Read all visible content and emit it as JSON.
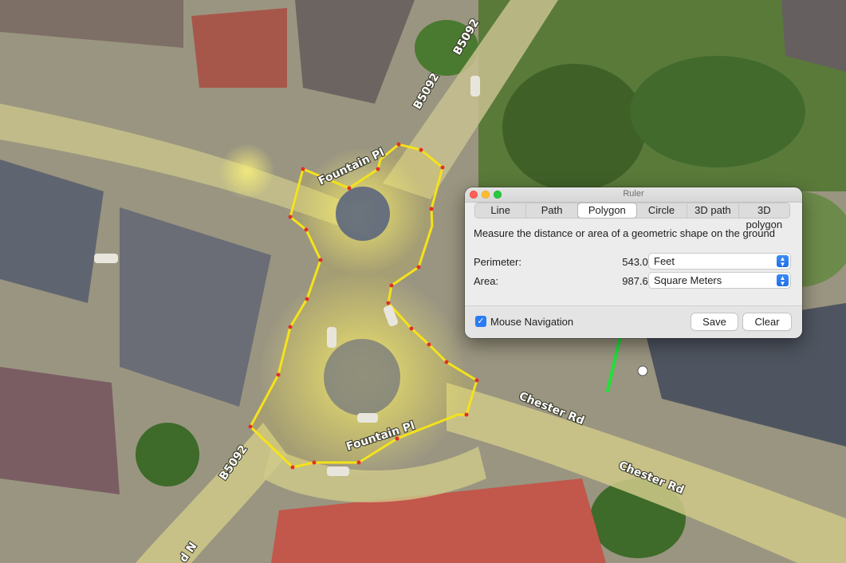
{
  "map": {
    "labels": {
      "fountain_pl_top": "Fountain Pl",
      "fountain_pl_bottom": "Fountain Pl",
      "b5092_a": "B5092",
      "b5092_b": "B5092",
      "b5092_c": "B5092",
      "chester_rd_a": "Chester Rd",
      "chester_rd_b": "Chester Rd",
      "road_fragment": "d N"
    },
    "polygon_color": "#f5e21b",
    "vertex_color": "#e0302a",
    "arrow_color": "#22e03a"
  },
  "ruler": {
    "title": "Ruler",
    "tabs": [
      {
        "label": "Line"
      },
      {
        "label": "Path"
      },
      {
        "label": "Polygon"
      },
      {
        "label": "Circle"
      },
      {
        "label": "3D path"
      },
      {
        "label": "3D polygon"
      }
    ],
    "active_tab": "Polygon",
    "description": "Measure the distance or area of a geometric shape on the ground",
    "perimeter": {
      "label": "Perimeter:",
      "value": "543.04",
      "unit": "Feet"
    },
    "area": {
      "label": "Area:",
      "value": "987.63",
      "unit": "Square Meters"
    },
    "mouse_navigation": {
      "label": "Mouse Navigation",
      "checked": true
    },
    "save_label": "Save",
    "clear_label": "Clear"
  }
}
